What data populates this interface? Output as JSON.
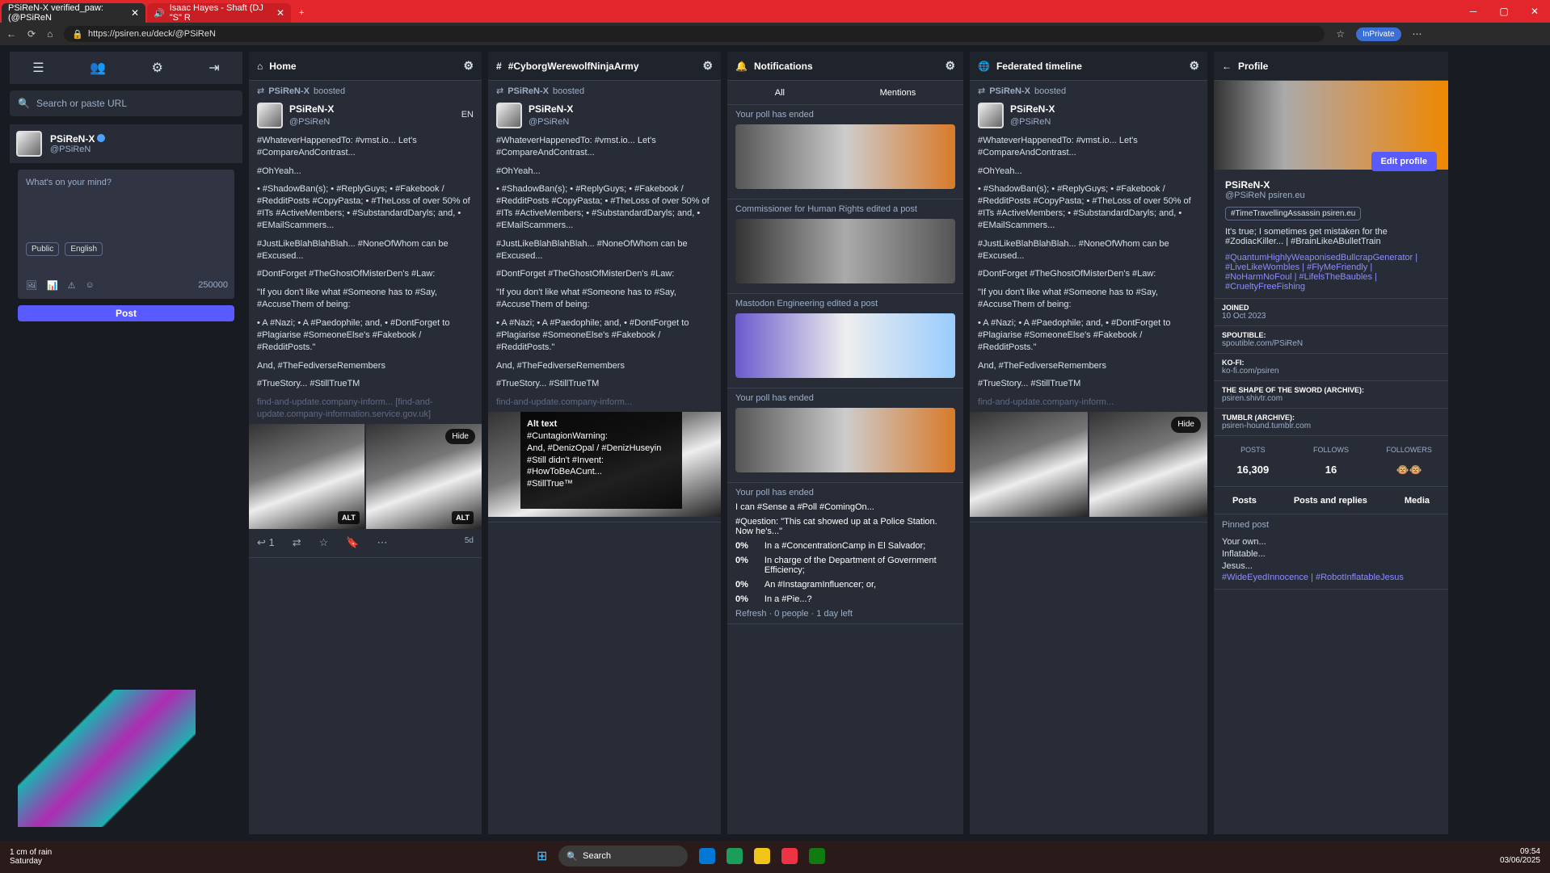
{
  "browser": {
    "tab1": "PSiReN-X verified_paw: (@PSiReN",
    "tab2": "Isaac Hayes - Shaft (DJ \"S\" R",
    "url": "https://psiren.eu/deck/@PSiReN",
    "inprivate": "InPrivate"
  },
  "left": {
    "search_placeholder": "Search or paste URL",
    "name": "PSiReN-X",
    "handle": "@PSiReN",
    "compose_placeholder": "What's on your mind?",
    "public": "Public",
    "english": "English",
    "count": "250000",
    "post": "Post"
  },
  "columns": {
    "home": "Home",
    "tag": "#CyborgWerewolfNinjaArmy",
    "notifications": "Notifications",
    "federated": "Federated timeline",
    "profile": "Profile"
  },
  "post": {
    "boosted": "PSiReN-X",
    "boosted_label": "boosted",
    "name": "PSiReN-X",
    "handle": "@PSiReN",
    "lang": "EN",
    "p1": "#WhateverHappenedTo: #vmst.io... Let's #CompareAndContrast...",
    "p2": "#OhYeah...",
    "bullets": "• #ShadowBan(s); • #ReplyGuys; • #Fakebook / #RedditPosts #CopyPasta; • #TheLoss of over 50% of #ITs #ActiveMembers; • #SubstandardDaryls; and, • #EMailScammers...",
    "p3": "#JustLikeBlahBlahBlah... #NoneOfWhom can be #Excused...",
    "p4": "#DontForget #TheGhostOfMisterDen's #Law:",
    "p5": "\"If you don't like what #Someone has to #Say, #AccuseThem of being:",
    "bullets2": "• A #Nazi; • A #Paedophile; and, • #DontForget to #Plagiarise #SomeoneElse's #Fakebook / #RedditPosts.\"",
    "p6": "And, #TheFediverseRemembers",
    "p7": "#TrueStory... #StillTrueTM",
    "link": "find-and-update.company-inform...",
    "link2": "[find-and-update.company-information.service.gov.uk]",
    "hide": "Hide",
    "alt": "ALT",
    "time": "5d",
    "replies": "1"
  },
  "alttext": {
    "title": "Alt text",
    "l1": "#CuntagionWarning:",
    "l2": "And, #DenizOpal / #DenizHuseyin #Still didn't #Invent: #HowToBeACunt...",
    "l3": "#StillTrue™"
  },
  "notif": {
    "all": "All",
    "mentions": "Mentions",
    "poll": "Your poll has ended",
    "edited1": "Commissioner for Human Rights edited a post",
    "edited2": "Mastodon Engineering edited a post",
    "question": "I can #Sense a #Poll #ComingOn...",
    "q": "#Question: \"This cat showed up at a Police Station. Now he's...\"",
    "o1": "In a #ConcentrationCamp in El Salvador;",
    "o2": "In charge of the Department of Government Efficiency;",
    "o3": "An #InstagramInfluencer; or,",
    "o4": "In a #Pie...?",
    "pct": "0%",
    "footer": "Refresh · 0 people · 1 day left"
  },
  "profile": {
    "edit": "Edit profile",
    "name": "PSiReN-X",
    "handle": "@PSiReN",
    "domain": "psiren.eu",
    "tag": "#TimeTravellingAssassin psiren.eu",
    "bio": "It's true; I sometimes get mistaken for the #ZodiacKiller... | #BrainLikeABulletTrain",
    "bio2": "#QuantumHighlyWeaponisedBullcrapGenerator | #LiveLikeWombles | #FlyMeFriendly | #NoHarmNoFoul | #LifelsTheBaubles | #CrueltyFreeFishing",
    "fields": [
      {
        "k": "JOINED",
        "v": "10 Oct 2023"
      },
      {
        "k": "SPOUTIBLE:",
        "v": "spoutible.com/PSiReN"
      },
      {
        "k": "KO-FI:",
        "v": "ko-fi.com/psiren"
      },
      {
        "k": "THE SHAPE OF THE SWORD (ARCHIVE):",
        "v": "psiren.shivtr.com"
      },
      {
        "k": "TUMBLR (ARCHIVE):",
        "v": "psiren-hound.tumblr.com"
      }
    ],
    "posts_k": "POSTS",
    "posts_v": "16,309",
    "follows_k": "FOLLOWS",
    "follows_v": "16",
    "followers_k": "FOLLOWERS",
    "followers_v": "🐵🐵",
    "tab1": "Posts",
    "tab2": "Posts and replies",
    "tab3": "Media",
    "pinned": "Pinned post",
    "l1": "Your own...",
    "l2": "Inflatable...",
    "l3": "Jesus...",
    "l4": "#WideEyedInnocence | #RobotInflatableJesus"
  },
  "taskbar": {
    "weather": "1 cm of rain",
    "day": "Saturday",
    "search": "Search",
    "time": "09:54",
    "date": "03/06/2025"
  }
}
